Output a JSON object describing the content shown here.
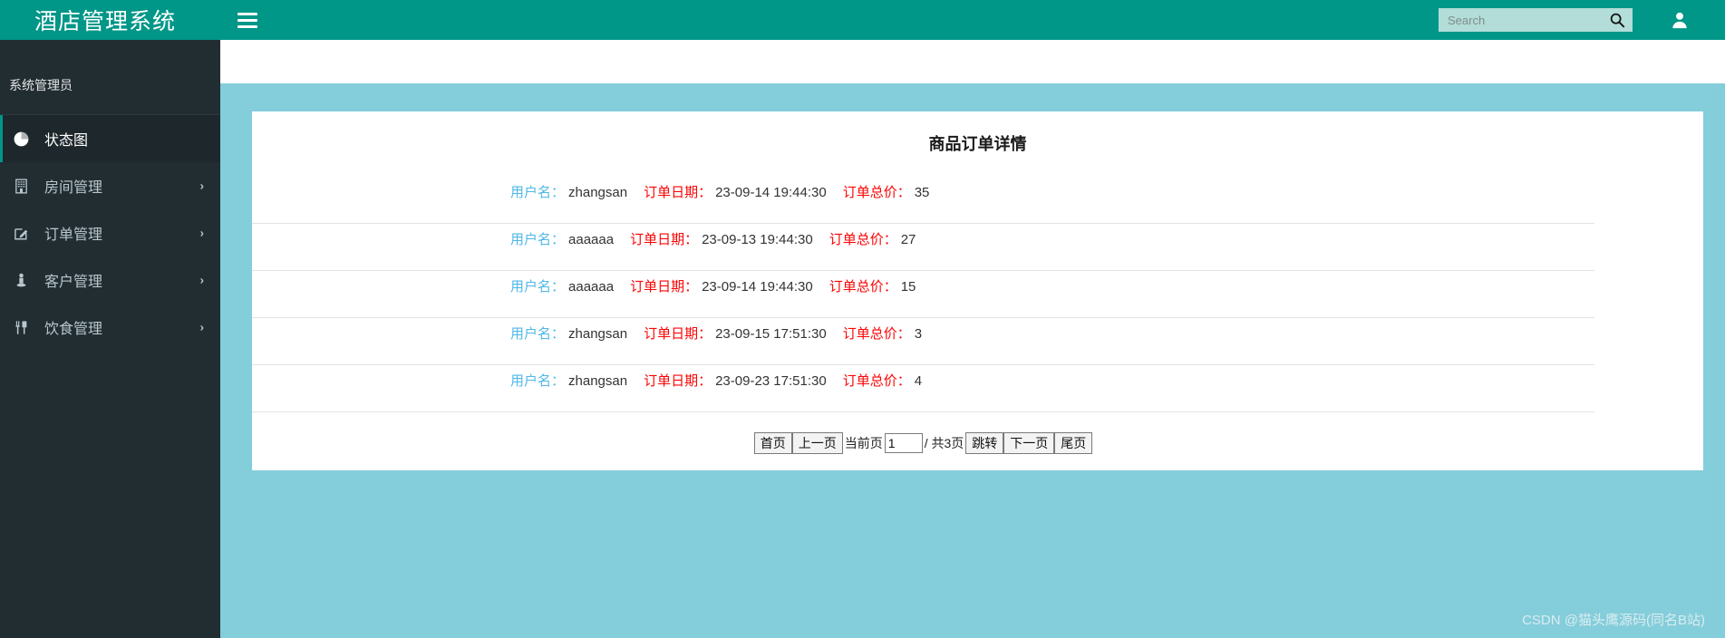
{
  "header": {
    "brand_title": "酒店管理系统",
    "hamburger_icon": "hamburger-menu-icon",
    "search": {
      "placeholder": "Search",
      "value": "",
      "icon": "search-icon"
    },
    "user_icon": "user-avatar-icon"
  },
  "sidebar": {
    "user_name": "系统管理员",
    "items": [
      {
        "label": "状态图",
        "icon": "pie-chart-icon",
        "active": true,
        "has_arrow": false,
        "arrow": ""
      },
      {
        "label": "房间管理",
        "icon": "building-icon",
        "active": false,
        "has_arrow": true,
        "arrow": "›"
      },
      {
        "label": "订单管理",
        "icon": "edit-square-icon",
        "active": false,
        "has_arrow": true,
        "arrow": "›"
      },
      {
        "label": "客户管理",
        "icon": "person-icon",
        "active": false,
        "has_arrow": true,
        "arrow": "›"
      },
      {
        "label": "饮食管理",
        "icon": "cutlery-icon",
        "active": false,
        "has_arrow": true,
        "arrow": "›"
      }
    ]
  },
  "main": {
    "card_title": "商品订单详情",
    "labels": {
      "user": "用户名：",
      "date": "订单日期：",
      "total": "订单总价："
    },
    "orders": [
      {
        "user": "zhangsan",
        "date": "23-09-14 19:44:30",
        "total": "35"
      },
      {
        "user": "aaaaaa",
        "date": "23-09-13 19:44:30",
        "total": "27"
      },
      {
        "user": "aaaaaa",
        "date": "23-09-14 19:44:30",
        "total": "15"
      },
      {
        "user": "zhangsan",
        "date": "23-09-15 17:51:30",
        "total": "3"
      },
      {
        "user": "zhangsan",
        "date": "23-09-23 17:51:30",
        "total": "4"
      }
    ],
    "pagination": {
      "first": "首页",
      "prev": "上一页",
      "current_label": "当前页",
      "current_value": "1",
      "total_label": "/ 共3页",
      "jump": "跳转",
      "next": "下一页",
      "last": "尾页"
    }
  },
  "watermark": "CSDN @猫头鹰源码(同名B站)",
  "colors": {
    "header_teal": "#009688",
    "sidebar_dark": "#222d32",
    "sidebar_active": "#1e282c",
    "body_blue": "#84cdda",
    "label_user_blue": "#4fb8e8",
    "label_red": "#fb0505",
    "card_white": "#ffffff"
  }
}
